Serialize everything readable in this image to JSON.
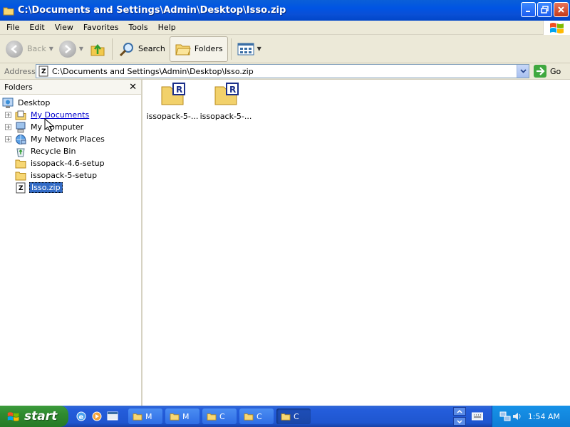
{
  "window": {
    "title": "C:\\Documents and Settings\\Admin\\Desktop\\Isso.zip"
  },
  "menu": {
    "items": [
      "File",
      "Edit",
      "View",
      "Favorites",
      "Tools",
      "Help"
    ]
  },
  "toolbar": {
    "back_label": "Back",
    "search_label": "Search",
    "folders_label": "Folders"
  },
  "address": {
    "label": "Address",
    "value": "C:\\Documents and Settings\\Admin\\Desktop\\Isso.zip",
    "go_label": "Go"
  },
  "folders_pane": {
    "title": "Folders",
    "items": [
      {
        "label": "Desktop"
      },
      {
        "label": "My Documents"
      },
      {
        "label": "My Computer"
      },
      {
        "label": "My Network Places"
      },
      {
        "label": "Recycle Bin"
      },
      {
        "label": "issopack-4.6-setup"
      },
      {
        "label": "issopack-5-setup"
      },
      {
        "label": "Isso.zip"
      }
    ]
  },
  "content": {
    "files": [
      {
        "label": "issopack-5-..."
      },
      {
        "label": "issopack-5-..."
      }
    ]
  },
  "taskbar": {
    "start_label": "start",
    "tasks": [
      {
        "label": "M"
      },
      {
        "label": "M"
      },
      {
        "label": "C"
      },
      {
        "label": "C"
      },
      {
        "label": "C"
      }
    ],
    "clock": "1:54 AM"
  }
}
